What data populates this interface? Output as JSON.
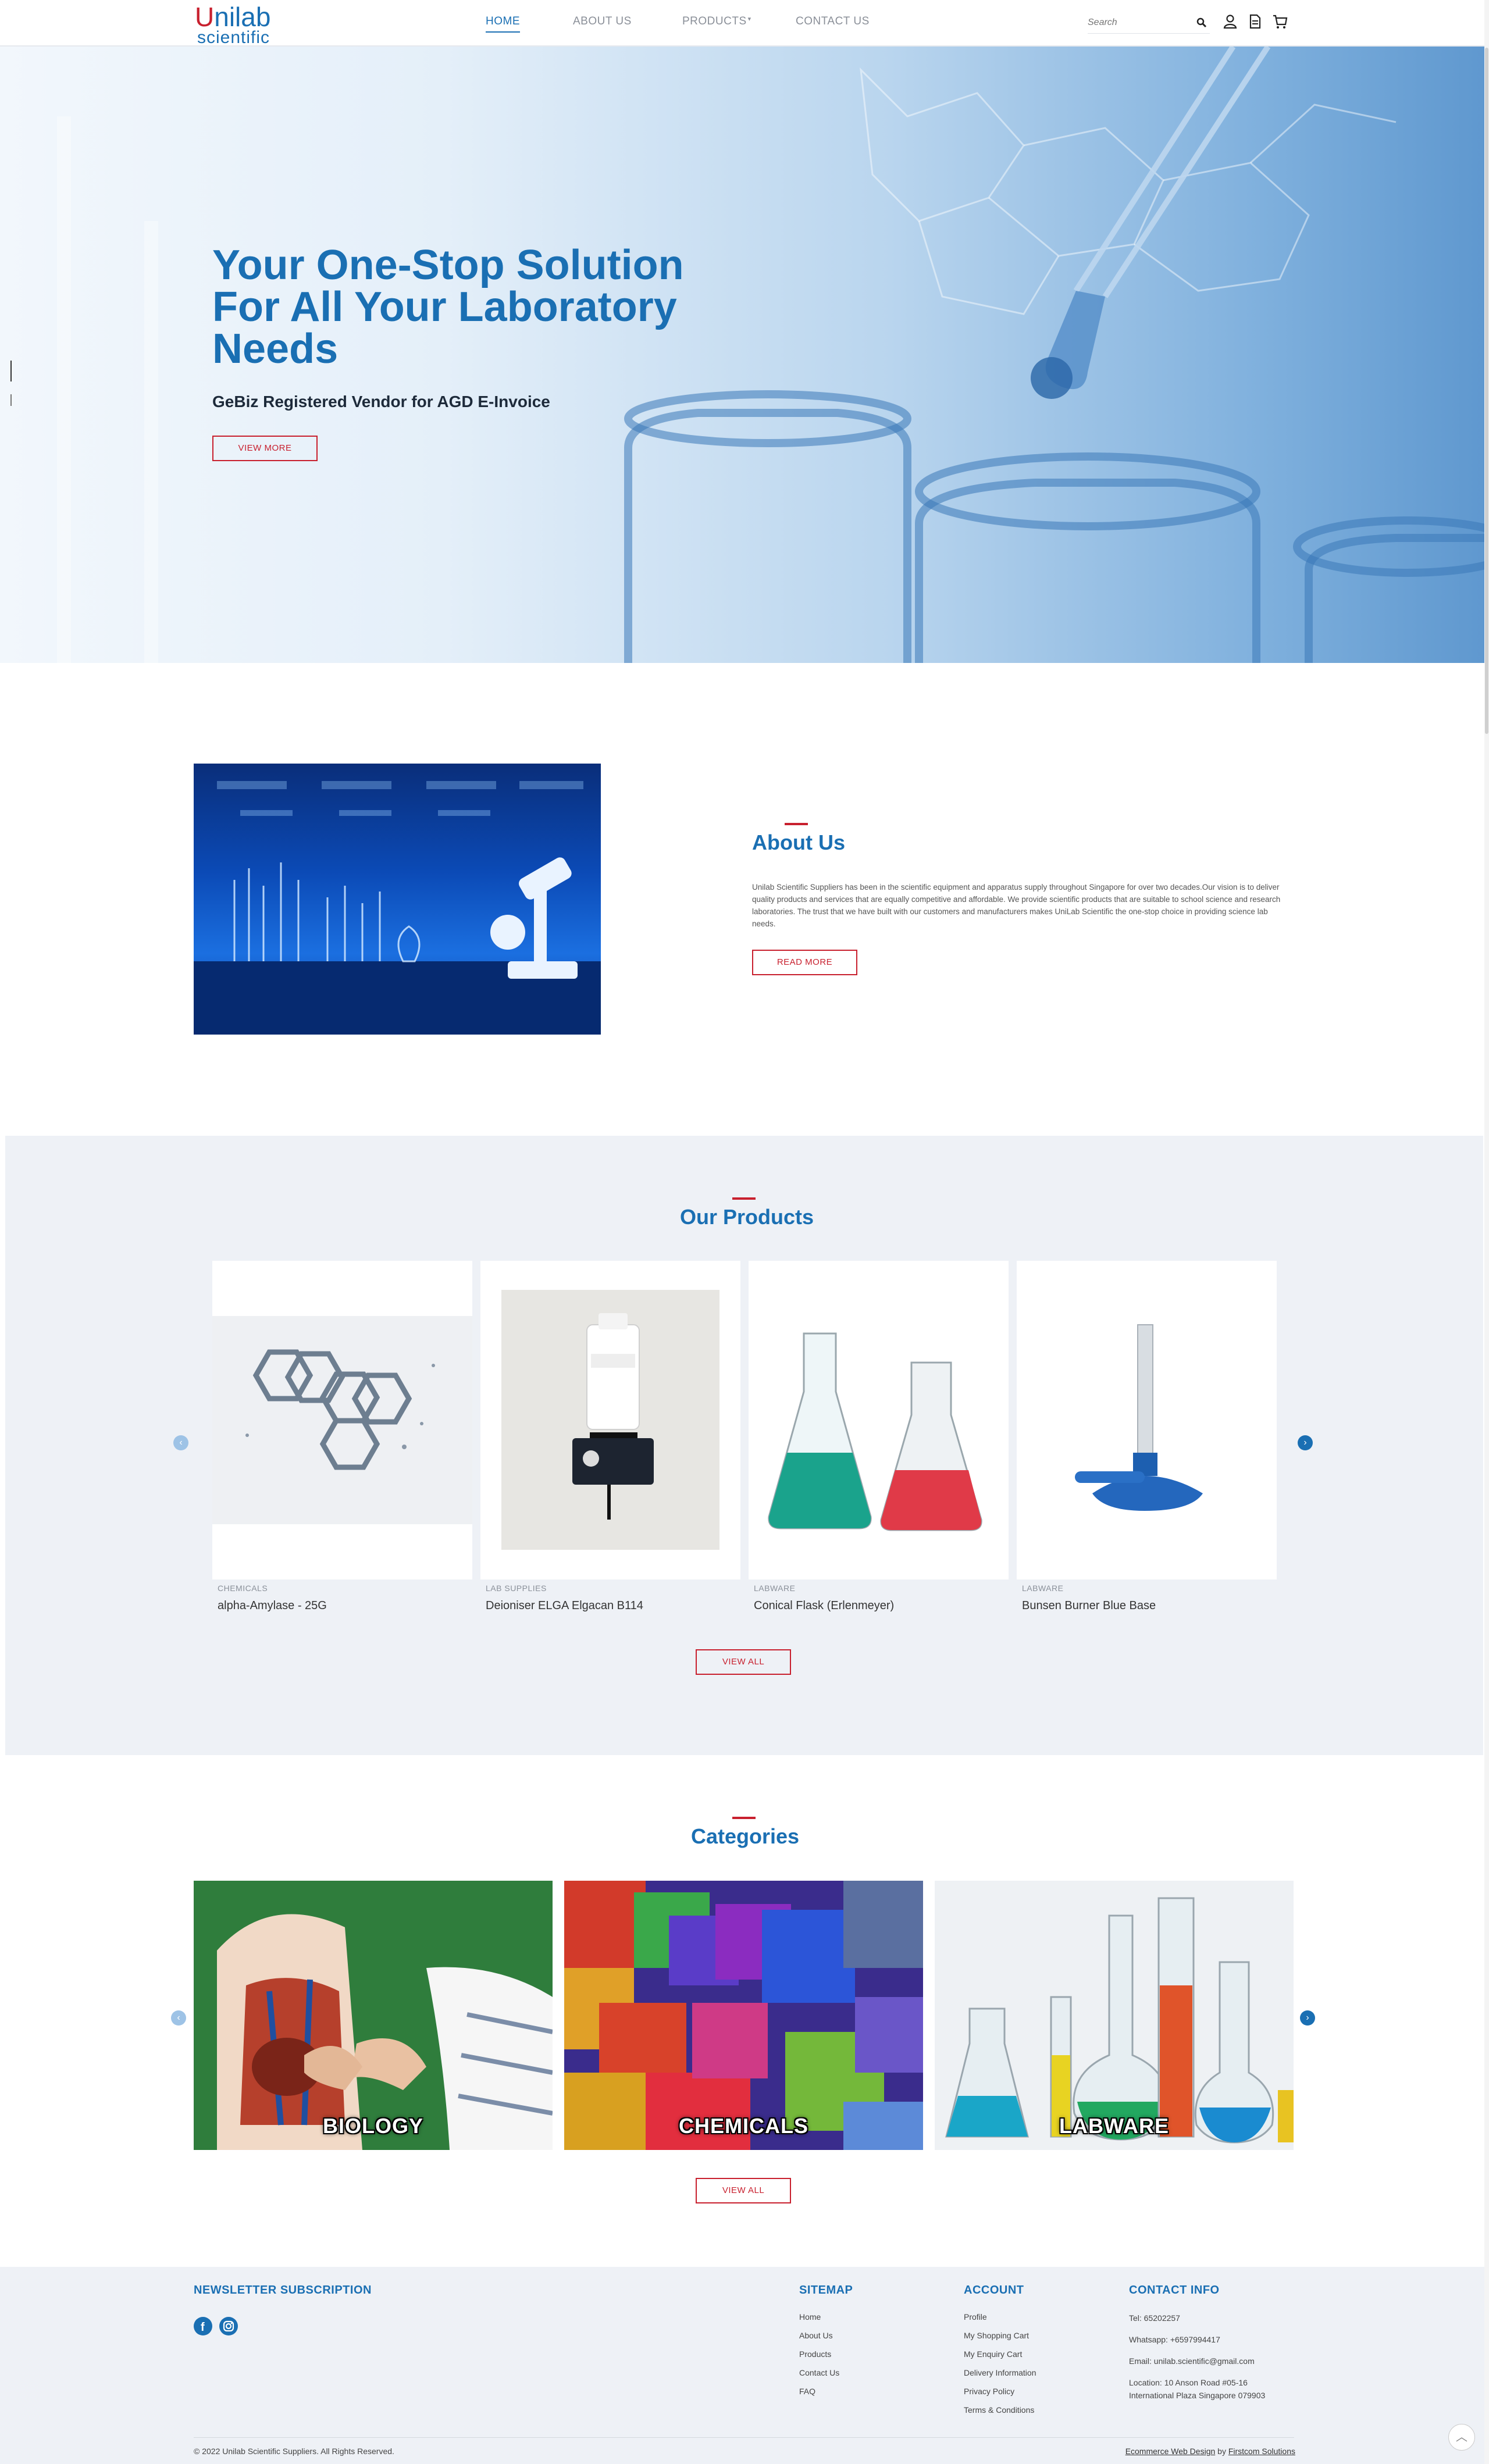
{
  "header": {
    "logo_u": "U",
    "logo_rest": "nilab",
    "logo_sub": "scientific",
    "nav": [
      {
        "label": "HOME"
      },
      {
        "label": "ABOUT US"
      },
      {
        "label": "PRODUCTS"
      },
      {
        "label": "CONTACT US"
      }
    ],
    "search_placeholder": "Search",
    "icons": [
      "user-icon",
      "enquiry-icon",
      "cart-icon"
    ]
  },
  "hero": {
    "title": "Your One-Stop Solution For All Your Laboratory Needs",
    "subtitle": "GeBiz Registered Vendor for AGD E-Invoice",
    "button": "VIEW MORE"
  },
  "about": {
    "title": "About Us",
    "text": "Unilab Scientific Suppliers has been in the scientific equipment and apparatus supply throughout Singapore for over two decades.Our vision is to deliver quality products and services that are equally competitive and affordable. We provide scientific products that are suitable to school science and research laboratories. The trust that we have built with our customers and manufacturers makes UniLab Scientific the one-stop choice in providing science lab needs.",
    "button": "READ MORE"
  },
  "products": {
    "title": "Our Products",
    "items": [
      {
        "category": "CHEMICALS",
        "name": "alpha-Amylase - 25G"
      },
      {
        "category": "LAB SUPPLIES",
        "name": "Deioniser ELGA Elgacan B114"
      },
      {
        "category": "LABWARE",
        "name": "Conical Flask (Erlenmeyer)"
      },
      {
        "category": "LABWARE",
        "name": "Bunsen Burner Blue Base"
      }
    ],
    "button": "VIEW ALL"
  },
  "categories": {
    "title": "Categories",
    "items": [
      {
        "label": "BIOLOGY"
      },
      {
        "label": "CHEMICALS"
      },
      {
        "label": "LABWARE"
      }
    ],
    "button": "VIEW ALL"
  },
  "footer": {
    "newsletter_title": "NEWSLETTER SUBSCRIPTION",
    "sitemap_title": "SITEMAP",
    "sitemap": [
      "Home",
      "About Us",
      "Products",
      "Contact Us",
      "FAQ"
    ],
    "account_title": "ACCOUNT",
    "account": [
      "Profile",
      "My Shopping Cart",
      "My Enquiry Cart",
      "Delivery Information",
      "Privacy Policy",
      "Terms & Conditions"
    ],
    "contact_title": "CONTACT INFO",
    "contact": {
      "tel": "Tel: 65202257",
      "whatsapp": "Whatsapp: +6597994417",
      "email": "Email: unilab.scientific@gmail.com",
      "location1": "Location: 10 Anson Road #05-16",
      "location2": "International Plaza Singapore 079903"
    },
    "copyright": "© 2022 Unilab Scientific Suppliers. All Rights Reserved.",
    "credit_link1": "Ecommerce Web Design",
    "credit_by": "by",
    "credit_link2": "Firstcom Solutions"
  },
  "colors": {
    "brand_blue": "#1a6fb3",
    "brand_red": "#c8202e",
    "section_bg": "#eef1f6"
  }
}
